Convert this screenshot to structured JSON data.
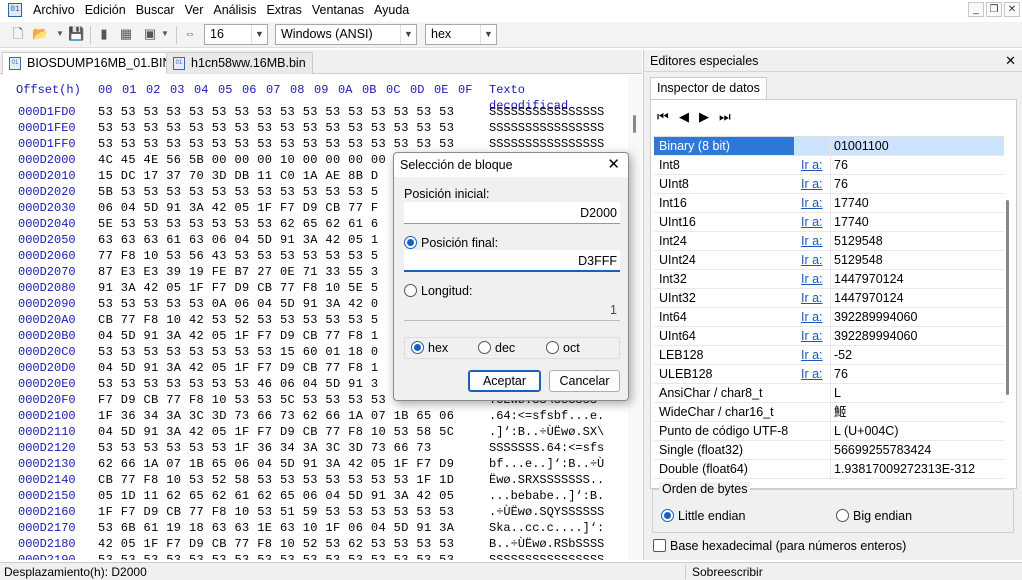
{
  "menu": [
    "Archivo",
    "Edición",
    "Buscar",
    "Ver",
    "Análisis",
    "Extras",
    "Ventanas",
    "Ayuda"
  ],
  "toolbar": {
    "bytes_per_row": "16",
    "charset": "Windows (ANSI)",
    "offset_base": "hex"
  },
  "tabs": [
    {
      "label": "BIOSDUMP16MB_01.BIN"
    },
    {
      "label": "h1cn58ww.16MB.bin"
    }
  ],
  "hex": {
    "header_offset": "Offset(h)",
    "header_cols": [
      "00",
      "01",
      "02",
      "03",
      "04",
      "05",
      "06",
      "07",
      "08",
      "09",
      "0A",
      "0B",
      "0C",
      "0D",
      "0E",
      "0F"
    ],
    "header_text": "Texto decodificad",
    "rows": [
      {
        "o": "000D1FD0",
        "b": "53 53 53 53 53 53 53 53 53 53 53 53 53 53 53 53",
        "t": "SSSSSSSSSSSSSSSS"
      },
      {
        "o": "000D1FE0",
        "b": "53 53 53 53 53 53 53 53 53 53 53 53 53 53 53 53",
        "t": "SSSSSSSSSSSSSSSS"
      },
      {
        "o": "000D1FF0",
        "b": "53 53 53 53 53 53 53 53 53 53 53 53 53 53 53 53",
        "t": "SSSSSSSSSSSSSSSS"
      },
      {
        "o": "000D2000",
        "b": "4C 45 4E 56 5B 00 00 00 10 00 00 00 00",
        "t": ""
      },
      {
        "o": "000D2010",
        "b": "15 DC 17 37 70 3D DB 11 C0 1A AE 8B D",
        "t": ""
      },
      {
        "o": "000D2020",
        "b": "5B 53 53 53 53 53 53 53 53 53 53 53 5",
        "t": ""
      },
      {
        "o": "000D2030",
        "b": "06 04 5D 91 3A 42 05 1F F7 D9 CB 77 F",
        "t": ""
      },
      {
        "o": "000D2040",
        "b": "5E 53 53 53 53 53 53 53 62 65 62 61 6",
        "t": ""
      },
      {
        "o": "000D2050",
        "b": "63 63 63 61 63 06 04 5D 91 3A 42 05 1",
        "t": ""
      },
      {
        "o": "000D2060",
        "b": "77 F8 10 53 56 43 53 53 53 53 53 53 5",
        "t": ""
      },
      {
        "o": "000D2070",
        "b": "87 E3 E3 39 19 FE B7 27 0E 71 33 55 3",
        "t": ""
      },
      {
        "o": "000D2080",
        "b": "91 3A 42 05 1F F7 D9 CB 77 F8 10 5E 5",
        "t": ""
      },
      {
        "o": "000D2090",
        "b": "53 53 53 53 53 0A 06 04 5D 91 3A 42 0",
        "t": ""
      },
      {
        "o": "000D20A0",
        "b": "CB 77 F8 10 42 53 52 53 53 53 53 53 5",
        "t": ""
      },
      {
        "o": "000D20B0",
        "b": "04 5D 91 3A 42 05 1F F7 D9 CB 77 F8 1",
        "t": ""
      },
      {
        "o": "000D20C0",
        "b": "53 53 53 53 53 53 53 53 15 60 01 18 0",
        "t": ""
      },
      {
        "o": "000D20D0",
        "b": "04 5D 91 3A 42 05 1F F7 D9 CB 77 F8 1",
        "t": ""
      },
      {
        "o": "000D20E0",
        "b": "53 53 53 53 53 53 53 46 06 04 5D 91 3",
        "t": ""
      },
      {
        "o": "000D20F0",
        "b": "F7 D9 CB 77 F8 10 53 53 5C 53 53 53 53",
        "t": ".ÙËwø.SS\\SSSSSS"
      },
      {
        "o": "000D2100",
        "b": "1F 36 34 3A 3C 3D 73 66 73 62 66 1A 07 1B 65 06",
        "t": ".64:<=sfsbf...e."
      },
      {
        "o": "000D2110",
        "b": "04 5D 91 3A 42 05 1F F7 D9 CB 77 F8 10 53 58 5C",
        "t": ".]‘:B..÷ÙËwø.SX\\"
      },
      {
        "o": "000D2120",
        "b": "53 53 53 53 53 53 1F 36 34 3A 3C 3D 73 66 73",
        "t": "SSSSSSS.64:<=sfs"
      },
      {
        "o": "000D2130",
        "b": "62 66 1A 07 1B 65 06 04 5D 91 3A 42 05 1F F7 D9",
        "t": "bf...e..]‘:B..÷Ù"
      },
      {
        "o": "000D2140",
        "b": "CB 77 F8 10 53 52 58 53 53 53 53 53 53 53 1F 1D",
        "t": "Ëwø.SRXSSSSSSS.."
      },
      {
        "o": "000D2150",
        "b": "05 1D 11 62 65 62 61 62 65 06 04 5D 91 3A 42 05",
        "t": "...bebabe..]‘:B."
      },
      {
        "o": "000D2160",
        "b": "1F F7 D9 CB 77 F8 10 53 51 59 53 53 53 53 53 53",
        "t": ".÷ÙËwø.SQYSSSSSS"
      },
      {
        "o": "000D2170",
        "b": "53 6B 61 19 18 63 63 1E 63 10 1F 06 04 5D 91 3A",
        "t": "Ska..cc.c....]‘:"
      },
      {
        "o": "000D2180",
        "b": "42 05 1F F7 D9 CB 77 F8 10 52 53 62 53 53 53 53",
        "t": "B..÷ÙËwø.RSbSSSS"
      },
      {
        "o": "000D2190",
        "b": "53 53 53 53 53 53 53 53 53 53 53 53 53 53 53 53",
        "t": "SSSSSSSSSSSSSSSS"
      }
    ]
  },
  "panel": {
    "title": "Editores especiales",
    "tab": "Inspector de datos",
    "goto_label": "Ir a:",
    "rows": [
      {
        "name": "Binary (8 bit)",
        "value": "01001100",
        "goto": false
      },
      {
        "name": "Int8",
        "value": "76",
        "goto": true
      },
      {
        "name": "UInt8",
        "value": "76",
        "goto": true
      },
      {
        "name": "Int16",
        "value": "17740",
        "goto": true
      },
      {
        "name": "UInt16",
        "value": "17740",
        "goto": true
      },
      {
        "name": "Int24",
        "value": "5129548",
        "goto": true
      },
      {
        "name": "UInt24",
        "value": "5129548",
        "goto": true
      },
      {
        "name": "Int32",
        "value": "1447970124",
        "goto": true
      },
      {
        "name": "UInt32",
        "value": "1447970124",
        "goto": true
      },
      {
        "name": "Int64",
        "value": "392289994060",
        "goto": true
      },
      {
        "name": "UInt64",
        "value": "392289994060",
        "goto": true
      },
      {
        "name": "LEB128",
        "value": "-52",
        "goto": true
      },
      {
        "name": "ULEB128",
        "value": "76",
        "goto": true
      },
      {
        "name": "AnsiChar / char8_t",
        "value": "L",
        "goto": false
      },
      {
        "name": "WideChar / char16_t",
        "value": "䱌",
        "goto": false
      },
      {
        "name": "Punto de código UTF-8",
        "value": "L (U+004C)",
        "goto": false
      },
      {
        "name": "Single (float32)",
        "value": "56699255783424",
        "goto": false
      },
      {
        "name": "Double (float64)",
        "value": "1.93817009272313E-312",
        "goto": false
      }
    ],
    "byte_order_label": "Orden de bytes",
    "little_endian": "Little endian",
    "big_endian": "Big endian",
    "hex_base_label": "Base hexadecimal (para números enteros)"
  },
  "dialog": {
    "title": "Selección de bloque",
    "start_label": "Posición inicial:",
    "start_value": "D2000",
    "end_label": "Posición final:",
    "end_value": "D3FFF",
    "length_label": "Longitud:",
    "length_value": "1",
    "base_hex": "hex",
    "base_dec": "dec",
    "base_oct": "oct",
    "ok": "Aceptar",
    "cancel": "Cancelar"
  },
  "status": {
    "offset": "Desplazamiento(h): D2000",
    "mode": "Sobreescribir"
  }
}
